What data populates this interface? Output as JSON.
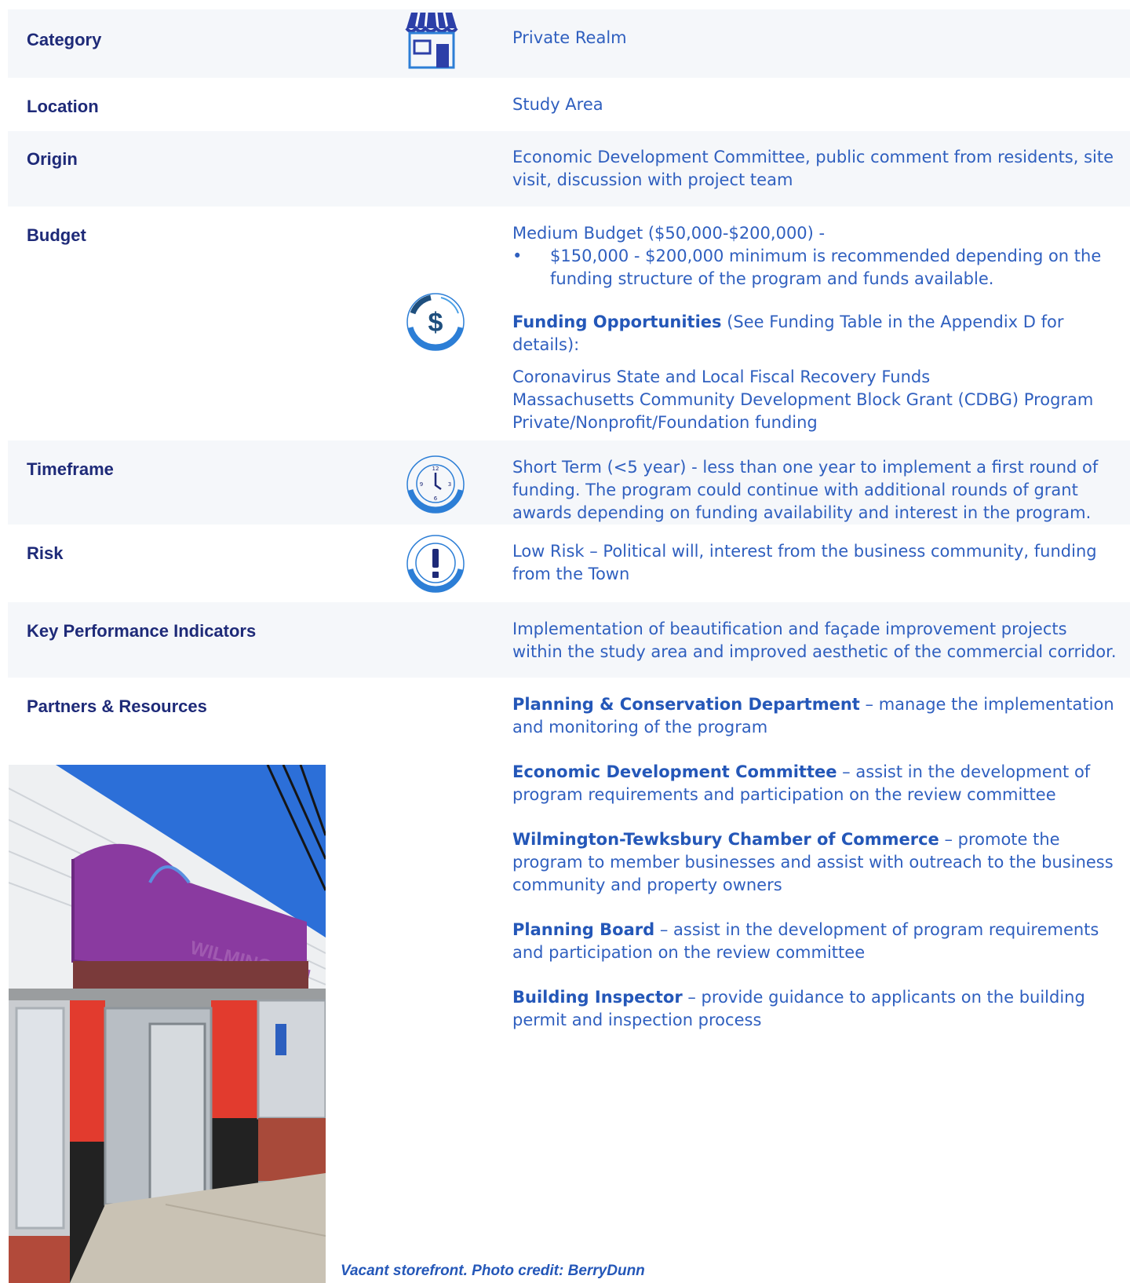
{
  "category": {
    "label": "Category",
    "value": "Private Realm",
    "icon": "storefront-icon"
  },
  "location": {
    "label": "Location",
    "value": "Study Area"
  },
  "origin": {
    "label": "Origin",
    "value": "Economic Development Committee, public comment from residents, site visit, discussion with project team"
  },
  "budget": {
    "label": "Budget",
    "icon": "dollar-icon",
    "line": "Medium Budget ($50,000-$200,000) -",
    "bullet": "$150,000 - $200,000 minimum is recommended depending on the funding structure of the program and funds available.",
    "funding_title": "Funding Opportunities",
    "funding_note": " (See Funding Table in the Appendix D for details):",
    "funding_sources": [
      "Coronavirus State and Local Fiscal Recovery Funds",
      "Massachusetts Community Development Block Grant (CDBG) Program",
      "Private/Nonprofit/Foundation funding"
    ]
  },
  "timeframe": {
    "label": "Timeframe",
    "icon": "clock-icon",
    "value": "Short Term (<5 year) - less than one year to implement a first round of funding. The program could continue with additional rounds of grant awards depending on funding availability and interest in the program."
  },
  "risk": {
    "label": "Risk",
    "icon": "exclamation-icon",
    "value": "Low Risk – Political will, interest from the business community, funding from the Town"
  },
  "kpi": {
    "label": "Key Performance Indicators",
    "value": "Implementation of beautification and façade improvement projects within the study area and improved aesthetic of the commercial corridor."
  },
  "partners": {
    "label": "Partners & Resources",
    "items": [
      {
        "name": "Planning & Conservation Department",
        "desc": " – manage the implementation and monitoring of the program"
      },
      {
        "name": "Economic Development Committee",
        "desc": " – assist in the development of program requirements and participation on the review committee"
      },
      {
        "name": "Wilmington-Tewksbury Chamber of Commerce",
        "desc": " – promote the program to member businesses and assist with outreach to the business community and property owners"
      },
      {
        "name": "Planning Board",
        "desc": " – assist in the development of program requirements and participation on the review committee"
      },
      {
        "name": "Building Inspector",
        "desc": " – provide guidance to applicants on the building permit and inspection process"
      }
    ]
  },
  "photo": {
    "caption": "Vacant storefront. Photo credit: BerryDunn",
    "sign_text": "WILMINGTON"
  }
}
